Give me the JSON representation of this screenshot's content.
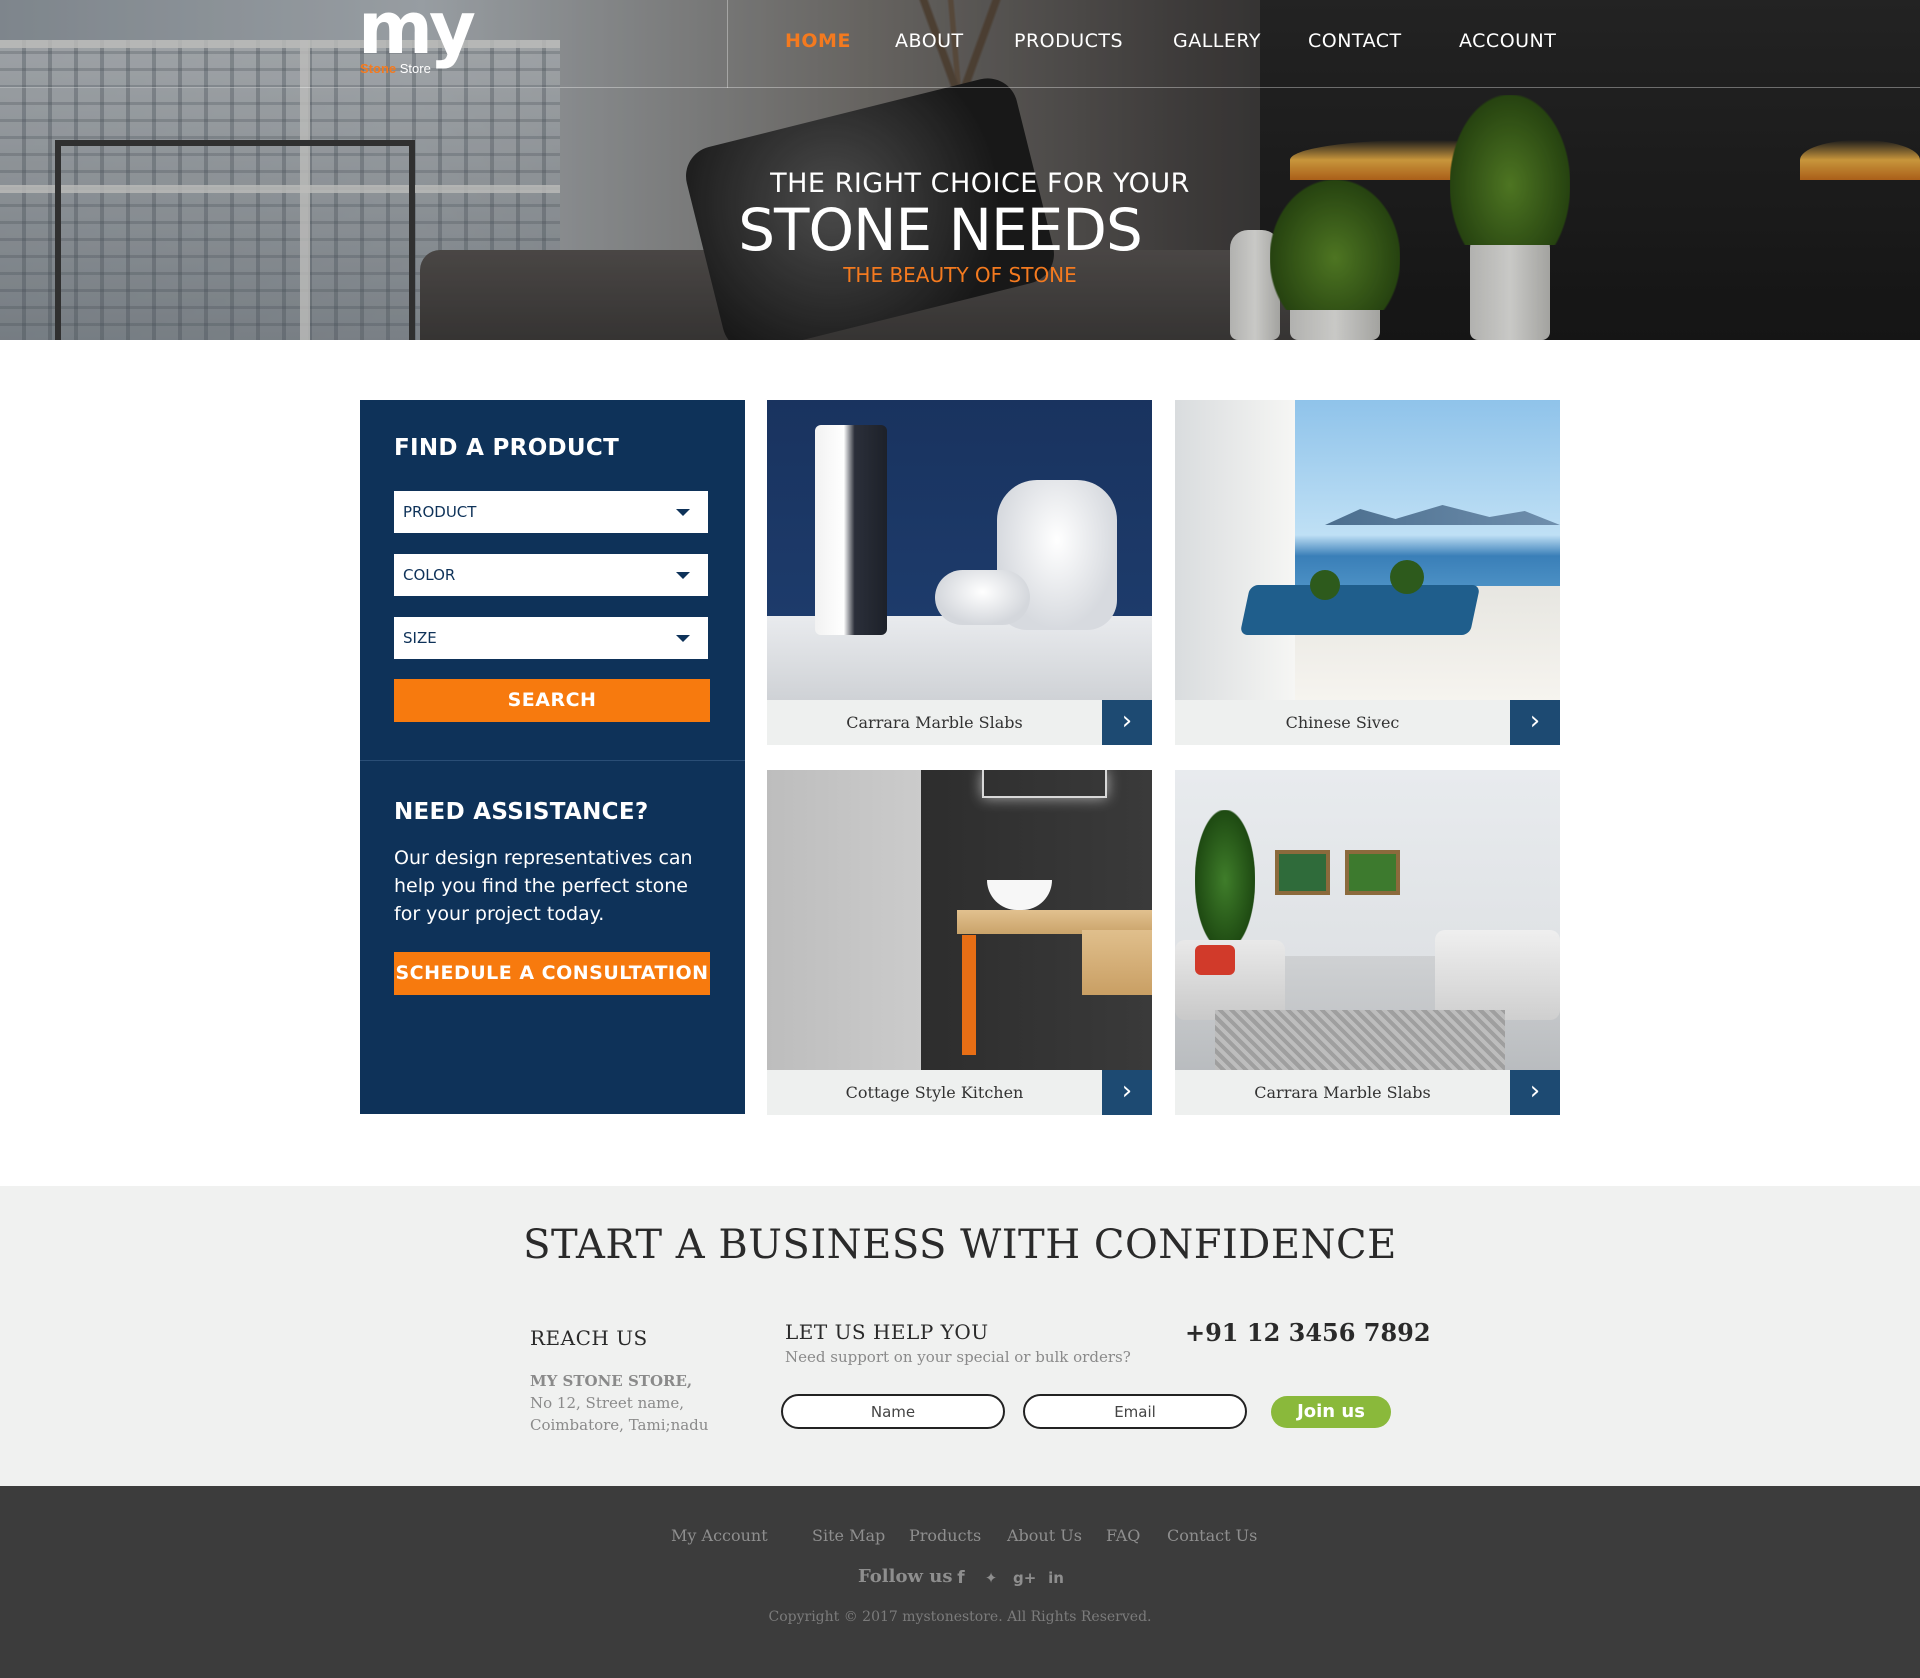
{
  "brand": {
    "logo_main": "my",
    "logo_sub_a": "Stone",
    "logo_sub_b": "Store",
    "accent_color": "#f47a1f",
    "navy_color": "#0e3259"
  },
  "nav": {
    "items": [
      {
        "label": "HOME",
        "active": true
      },
      {
        "label": "ABOUT",
        "active": false
      },
      {
        "label": "PRODUCTS",
        "active": false
      },
      {
        "label": "GALLERY",
        "active": false
      },
      {
        "label": "CONTACT",
        "active": false
      },
      {
        "label": "ACCOUNT",
        "active": false
      }
    ]
  },
  "hero": {
    "line1": "THE RIGHT CHOICE  FOR YOUR",
    "line2": "STONE NEEDS",
    "line3": "THE BEAUTY OF STONE"
  },
  "finder": {
    "title": "FIND A PRODUCT",
    "selects": [
      "PRODUCT",
      "COLOR",
      "SIZE"
    ],
    "search_label": "SEARCH"
  },
  "assist": {
    "title": "NEED ASSISTANCE?",
    "text": "Our design representatives can help you find the perfect stone for your project today.",
    "button_label": "SCHEDULE A CONSULTATION"
  },
  "cards": [
    {
      "caption": "Carrara Marble Slabs",
      "arrow": "›",
      "scene": "living-blue"
    },
    {
      "caption": "Chinese Sivec",
      "arrow": "›",
      "scene": "balcony"
    },
    {
      "caption": "Cottage Style Kitchen",
      "arrow": "›",
      "scene": "bath"
    },
    {
      "caption": "Carrara Marble Slabs",
      "arrow": "›",
      "scene": "lounge"
    }
  ],
  "business": {
    "title": "START A BUSINESS WITH CONFIDENCE",
    "reach_title": "REACH US",
    "address": [
      "MY STONE STORE,",
      "No 12, Street name,",
      "Coimbatore, Tami;nadu"
    ],
    "help_title": "LET US HELP YOU",
    "help_sub": "Need support on your special or bulk orders?",
    "phone": "+91 12 3456 7892",
    "name_placeholder": "Name",
    "email_placeholder": "Email",
    "join_label": "Join us"
  },
  "footer": {
    "links": [
      "My Account",
      "Site Map",
      "Products",
      "About Us",
      "FAQ",
      "Contact Us"
    ],
    "follow_label": "Follow us",
    "social": [
      {
        "icon": "facebook-icon",
        "glyph": "f"
      },
      {
        "icon": "twitter-icon",
        "glyph": "✦"
      },
      {
        "icon": "google-plus-icon",
        "glyph": "g+"
      },
      {
        "icon": "linkedin-icon",
        "glyph": "in"
      }
    ],
    "copyright": "Copyright  © 2017  mystonestore.  All Rights Reserved."
  }
}
